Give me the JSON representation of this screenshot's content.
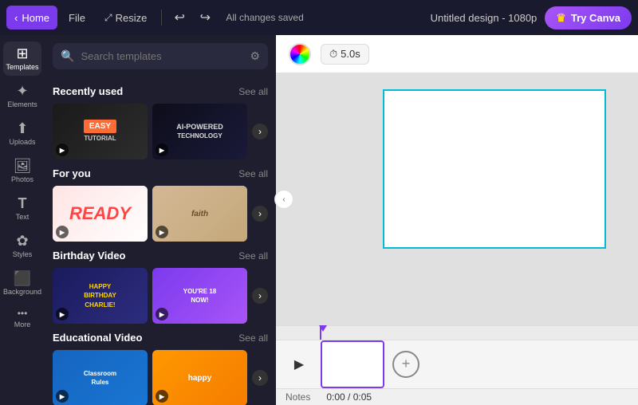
{
  "navbar": {
    "home_label": "Home",
    "file_label": "File",
    "resize_label": "Resize",
    "status": "All changes saved",
    "title": "Untitled design - 1080p",
    "try_canva_label": "Try Canva"
  },
  "sidebar": {
    "items": [
      {
        "id": "templates",
        "label": "Templates",
        "icon": "⊞"
      },
      {
        "id": "elements",
        "label": "Elements",
        "icon": "✦"
      },
      {
        "id": "uploads",
        "label": "Uploads",
        "icon": "⬆"
      },
      {
        "id": "photos",
        "label": "Photos",
        "icon": "🖼"
      },
      {
        "id": "text",
        "label": "Text",
        "icon": "T"
      },
      {
        "id": "styles",
        "label": "Styles",
        "icon": "✿"
      },
      {
        "id": "background",
        "label": "Background",
        "icon": "⬛"
      },
      {
        "id": "more",
        "label": "More",
        "icon": "···"
      }
    ]
  },
  "search": {
    "placeholder": "Search templates"
  },
  "sections": [
    {
      "id": "recently_used",
      "title": "Recently used",
      "see_all": "See all",
      "templates": [
        {
          "id": "easy_tutorial",
          "label": "EASY\nTUTORIAL",
          "bg": "thumb-easy"
        },
        {
          "id": "ai_powered",
          "label": "AI-POWERED\nTECHNOLOGY",
          "bg": "thumb-ai"
        }
      ]
    },
    {
      "id": "for_you",
      "title": "For you",
      "see_all": "See all",
      "templates": [
        {
          "id": "ready",
          "label": "READY",
          "bg": "thumb-ready"
        },
        {
          "id": "faith",
          "label": "faith",
          "bg": "thumb-faith"
        }
      ]
    },
    {
      "id": "birthday_video",
      "title": "Birthday Video",
      "see_all": "See all",
      "templates": [
        {
          "id": "happy_birthday",
          "label": "HAPPY\nBIRTHDAY\nCHARLIE!",
          "bg": "thumb-birthday"
        },
        {
          "id": "youre_18",
          "label": "YOU'RE 18\nNOW!",
          "bg": "thumb-youre"
        }
      ]
    },
    {
      "id": "educational_video",
      "title": "Educational Video",
      "see_all": "See all",
      "templates": [
        {
          "id": "classroom",
          "label": "Classroom\nRules",
          "bg": "thumb-classroom"
        },
        {
          "id": "happy_edu",
          "label": "happy",
          "bg": "thumb-happy"
        }
      ]
    }
  ],
  "canvas": {
    "timer": "5.0s"
  },
  "timeline": {
    "notes_label": "Notes",
    "time_display": "0:00 / 0:05"
  }
}
